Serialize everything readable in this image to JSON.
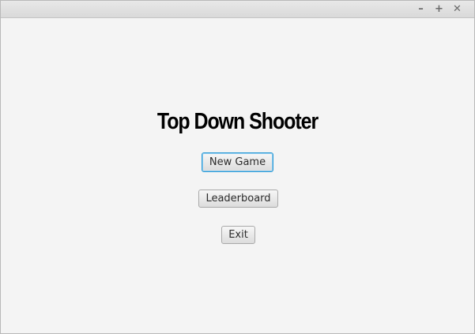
{
  "window": {
    "controls": {
      "minimize": "–",
      "maximize": "+",
      "close": "✕"
    }
  },
  "menu": {
    "title": "Top Down Shooter",
    "buttons": {
      "new_game": "New Game",
      "leaderboard": "Leaderboard",
      "exit": "Exit"
    },
    "focused_button": "new_game"
  },
  "colors": {
    "background": "#f4f4f4",
    "focus_ring": "#2a9ad6",
    "title_text": "#000000"
  }
}
